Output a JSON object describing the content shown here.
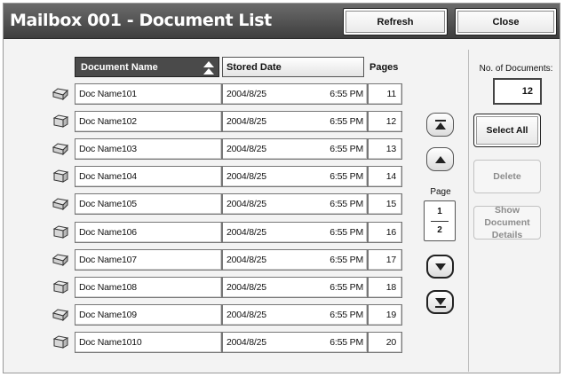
{
  "header": {
    "title": "Mailbox 001 - Document List",
    "refresh_label": "Refresh",
    "close_label": "Close"
  },
  "columns": {
    "name": "Document Name",
    "stored": "Stored Date",
    "pages": "Pages"
  },
  "documents": [
    {
      "name": "Doc Name101",
      "date": "2004/8/25",
      "time": "6:55 PM",
      "pages": "11",
      "icon": "document-icon-open"
    },
    {
      "name": "Doc Name102",
      "date": "2004/8/25",
      "time": "6:55 PM",
      "pages": "12",
      "icon": "document-icon-box"
    },
    {
      "name": "Doc Name103",
      "date": "2004/8/25",
      "time": "6:55 PM",
      "pages": "13",
      "icon": "document-icon-open"
    },
    {
      "name": "Doc Name104",
      "date": "2004/8/25",
      "time": "6:55 PM",
      "pages": "14",
      "icon": "document-icon-box"
    },
    {
      "name": "Doc Name105",
      "date": "2004/8/25",
      "time": "6:55 PM",
      "pages": "15",
      "icon": "document-icon-open"
    },
    {
      "name": "Doc Name106",
      "date": "2004/8/25",
      "time": "6:55 PM",
      "pages": "16",
      "icon": "document-icon-box"
    },
    {
      "name": "Doc Name107",
      "date": "2004/8/25",
      "time": "6:55 PM",
      "pages": "17",
      "icon": "document-icon-open"
    },
    {
      "name": "Doc Name108",
      "date": "2004/8/25",
      "time": "6:55 PM",
      "pages": "18",
      "icon": "document-icon-box"
    },
    {
      "name": "Doc Name109",
      "date": "2004/8/25",
      "time": "6:55 PM",
      "pages": "19",
      "icon": "document-icon-open"
    },
    {
      "name": "Doc Name1010",
      "date": "2004/8/25",
      "time": "6:55 PM",
      "pages": "20",
      "icon": "document-icon-box"
    }
  ],
  "pager": {
    "label": "Page",
    "current": "1",
    "total": "2"
  },
  "summary": {
    "count_label": "No. of Documents:",
    "count_value": "12"
  },
  "actions": {
    "select_all": "Select All",
    "delete": "Delete",
    "show_details": "Show Document Details"
  }
}
